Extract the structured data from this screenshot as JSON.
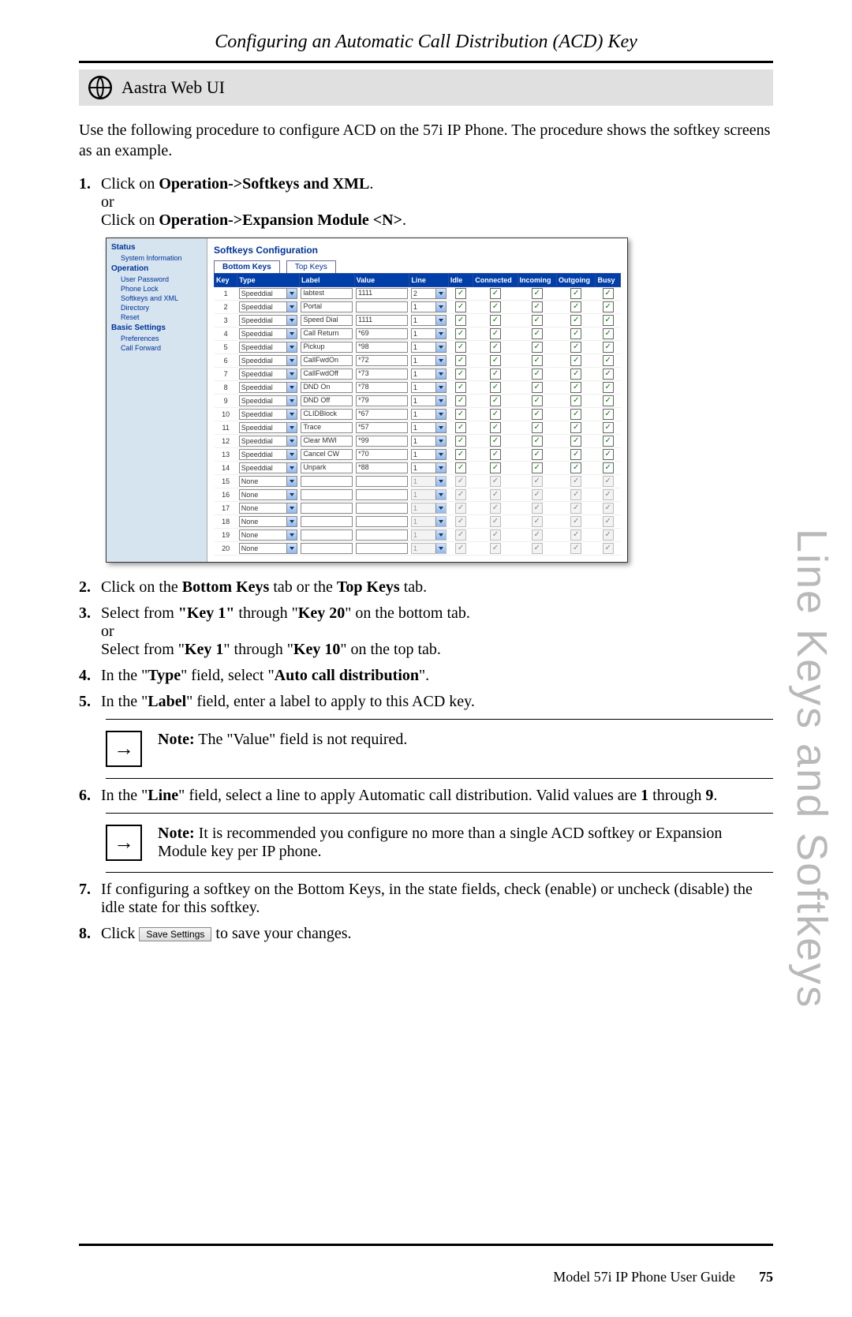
{
  "header": {
    "section_title": "Configuring an Automatic Call Distribution (ACD) Key",
    "ui_bar_label": "Aastra Web UI"
  },
  "intro": "Use the following procedure to configure ACD on the 57i IP Phone. The procedure shows the softkey screens as an example.",
  "steps": {
    "s1_a": "Click on ",
    "s1_b": "Operation->Softkeys and XML",
    "s1_c": "or",
    "s1_d": "Click on ",
    "s1_e": "Operation->Expansion Module <N>",
    "s2_a": "Click on the ",
    "s2_b": "Bottom Keys",
    "s2_c": " tab or the ",
    "s2_d": "Top Keys",
    "s2_e": " tab.",
    "s3_a": "Select from ",
    "s3_b": "\"Key 1\"",
    "s3_c": " through \"",
    "s3_d": "Key 20",
    "s3_e": "\" on the bottom tab.",
    "s3_f": "or",
    "s3_g": "Select from \"",
    "s3_h": "Key 1",
    "s3_i": "\" through \"",
    "s3_j": "Key 10",
    "s3_k": "\" on the top tab.",
    "s4_a": "In the \"",
    "s4_b": "Type",
    "s4_c": "\" field, select \"",
    "s4_d": "Auto call distribution",
    "s4_e": "\".",
    "s5_a": "In the \"",
    "s5_b": "Label",
    "s5_c": "\" field, enter a label to apply to this ACD key.",
    "s6_a": "In the \"",
    "s6_b": "Line",
    "s6_c": "\" field, select a line to apply Automatic call distribution. Valid values are ",
    "s6_d": "1",
    "s6_e": " through ",
    "s6_f": "9",
    "s6_g": ".",
    "s7": "If configuring a softkey on the Bottom Keys, in the state fields, check (enable) or uncheck (disable) the idle state for this softkey.",
    "s8_a": "Click ",
    "s8_b": " to save your changes."
  },
  "note1_label": "Note:",
  "note1_text": " The \"Value\" field is not required.",
  "note2_label": "Note:",
  "note2_text": " It is recommended you configure no more than a single ACD softkey or Expansion Module key per IP phone.",
  "screenshot": {
    "sidebar": {
      "groups": [
        {
          "heading": "Status",
          "items": [
            "System Information"
          ]
        },
        {
          "heading": "Operation",
          "items": [
            "User Password",
            "Phone Lock",
            "Softkeys and XML",
            "Directory",
            "Reset"
          ]
        },
        {
          "heading": "Basic Settings",
          "items": [
            "Preferences",
            "Call Forward"
          ]
        }
      ]
    },
    "title": "Softkeys Configuration",
    "tabs": {
      "active": "Bottom Keys",
      "other": "Top Keys"
    },
    "columns": [
      "Key",
      "Type",
      "Label",
      "Value",
      "Line",
      "Idle",
      "Connected",
      "Incoming",
      "Outgoing",
      "Busy"
    ],
    "rows": [
      {
        "key": "1",
        "type": "Speeddial",
        "label": "labtest",
        "value": "1111",
        "line": "2",
        "enabled": true
      },
      {
        "key": "2",
        "type": "Speeddial",
        "label": "Portal",
        "value": "",
        "line": "1",
        "enabled": true
      },
      {
        "key": "3",
        "type": "Speeddial",
        "label": "Speed Dial",
        "value": "1111",
        "line": "1",
        "enabled": true
      },
      {
        "key": "4",
        "type": "Speeddial",
        "label": "Call Return",
        "value": "*69",
        "line": "1",
        "enabled": true
      },
      {
        "key": "5",
        "type": "Speeddial",
        "label": "Pickup",
        "value": "*98",
        "line": "1",
        "enabled": true
      },
      {
        "key": "6",
        "type": "Speeddial",
        "label": "CallFwdOn",
        "value": "*72",
        "line": "1",
        "enabled": true
      },
      {
        "key": "7",
        "type": "Speeddial",
        "label": "CallFwdOff",
        "value": "*73",
        "line": "1",
        "enabled": true
      },
      {
        "key": "8",
        "type": "Speeddial",
        "label": "DND On",
        "value": "*78",
        "line": "1",
        "enabled": true
      },
      {
        "key": "9",
        "type": "Speeddial",
        "label": "DND Off",
        "value": "*79",
        "line": "1",
        "enabled": true
      },
      {
        "key": "10",
        "type": "Speeddial",
        "label": "CLIDBlock",
        "value": "*67",
        "line": "1",
        "enabled": true
      },
      {
        "key": "11",
        "type": "Speeddial",
        "label": "Trace",
        "value": "*57",
        "line": "1",
        "enabled": true
      },
      {
        "key": "12",
        "type": "Speeddial",
        "label": "Clear MWI",
        "value": "*99",
        "line": "1",
        "enabled": true
      },
      {
        "key": "13",
        "type": "Speeddial",
        "label": "Cancel CW",
        "value": "*70",
        "line": "1",
        "enabled": true
      },
      {
        "key": "14",
        "type": "Speeddial",
        "label": "Unpark",
        "value": "*88",
        "line": "1",
        "enabled": true
      },
      {
        "key": "15",
        "type": "None",
        "label": "",
        "value": "",
        "line": "1",
        "enabled": false
      },
      {
        "key": "16",
        "type": "None",
        "label": "",
        "value": "",
        "line": "1",
        "enabled": false
      },
      {
        "key": "17",
        "type": "None",
        "label": "",
        "value": "",
        "line": "1",
        "enabled": false
      },
      {
        "key": "18",
        "type": "None",
        "label": "",
        "value": "",
        "line": "1",
        "enabled": false
      },
      {
        "key": "19",
        "type": "None",
        "label": "",
        "value": "",
        "line": "1",
        "enabled": false
      },
      {
        "key": "20",
        "type": "None",
        "label": "",
        "value": "",
        "line": "1",
        "enabled": false
      }
    ]
  },
  "save_button_label": "Save Settings",
  "side_title": "Line Keys and Softkeys",
  "footer": {
    "guide": "Model 57i IP Phone User Guide",
    "page": "75"
  }
}
